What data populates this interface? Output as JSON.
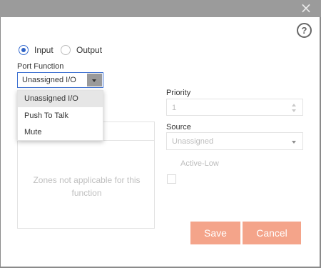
{
  "window": {
    "close_glyph": "×"
  },
  "help": {
    "glyph": "?"
  },
  "direction": {
    "input_label": "Input",
    "output_label": "Output",
    "selected": "Input"
  },
  "port_function": {
    "label": "Port Function",
    "value": "Unassigned I/O",
    "options": [
      "Unassigned I/O",
      "Push To Talk",
      "Mute"
    ]
  },
  "zones": {
    "message": "Zones not applicable for this function"
  },
  "priority": {
    "label": "Priority",
    "value": "1"
  },
  "source": {
    "label": "Source",
    "value": "Unassigned"
  },
  "active_low": {
    "label": "Active-Low",
    "checked": false
  },
  "buttons": {
    "save": "Save",
    "cancel": "Cancel"
  },
  "colors": {
    "accent": "#2f63c6",
    "button": "#f4a48a",
    "overlay": "#8a8a8a"
  }
}
